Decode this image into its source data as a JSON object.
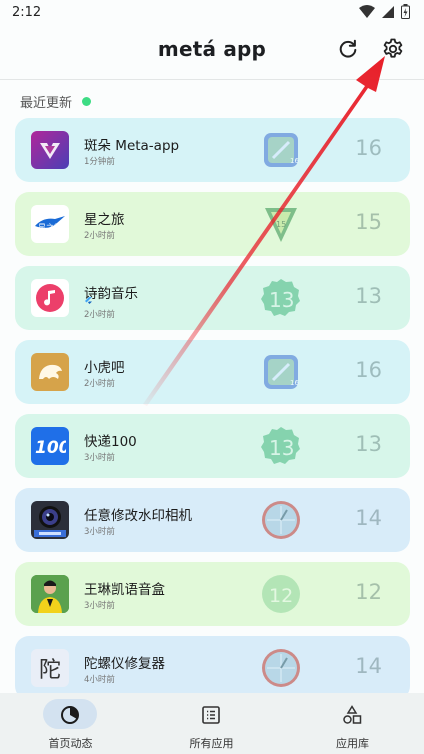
{
  "status": {
    "time": "2:12"
  },
  "header": {
    "title": "metá app"
  },
  "section": {
    "title": "最近更新"
  },
  "apps": [
    {
      "name": "斑朵 Meta-app",
      "time": "1分钟前",
      "version": "16",
      "bg": "#d6f3f7",
      "icon": "meta-app-icon",
      "ver_icon": "android-16-icon"
    },
    {
      "name": "星之旅",
      "time": "2小时前",
      "version": "15",
      "bg": "#e1f9d9",
      "icon": "xingzhilv-icon",
      "ver_icon": "android-15-icon"
    },
    {
      "name": "诗韵音乐",
      "time": "2小时前",
      "version": "13",
      "bg": "#d7f6ea",
      "icon": "music-note-icon",
      "ver_icon": "android-13-icon"
    },
    {
      "name": "小虎吧",
      "time": "2小时前",
      "version": "16",
      "bg": "#d6f3f7",
      "icon": "tiger-icon",
      "ver_icon": "android-16-icon"
    },
    {
      "name": "快递100",
      "time": "3小时前",
      "version": "13",
      "bg": "#d7f6ea",
      "icon": "kuaidi100-icon",
      "ver_icon": "android-13-icon"
    },
    {
      "name": "任意修改水印相机",
      "time": "3小时前",
      "version": "14",
      "bg": "#d8ecf9",
      "icon": "camera-lens-icon",
      "ver_icon": "android-14-icon"
    },
    {
      "name": "王琳凯语音盒",
      "time": "3小时前",
      "version": "12",
      "bg": "#e1f9d9",
      "icon": "person-photo-icon",
      "ver_icon": "android-12-icon"
    },
    {
      "name": "陀螺仪修复器",
      "time": "4小时前",
      "version": "14",
      "bg": "#d8ecf9",
      "icon": "tuo-char-icon",
      "ver_icon": "android-14-icon"
    }
  ],
  "nav": [
    {
      "label": "首页动态",
      "icon": "dashboard-icon"
    },
    {
      "label": "所有应用",
      "icon": "list-icon"
    },
    {
      "label": "应用库",
      "icon": "shapes-icon"
    }
  ],
  "colors": {
    "accent_pill": "#d3e2f0",
    "online_dot": "#3ddc84",
    "arrow": "#e8202a"
  }
}
